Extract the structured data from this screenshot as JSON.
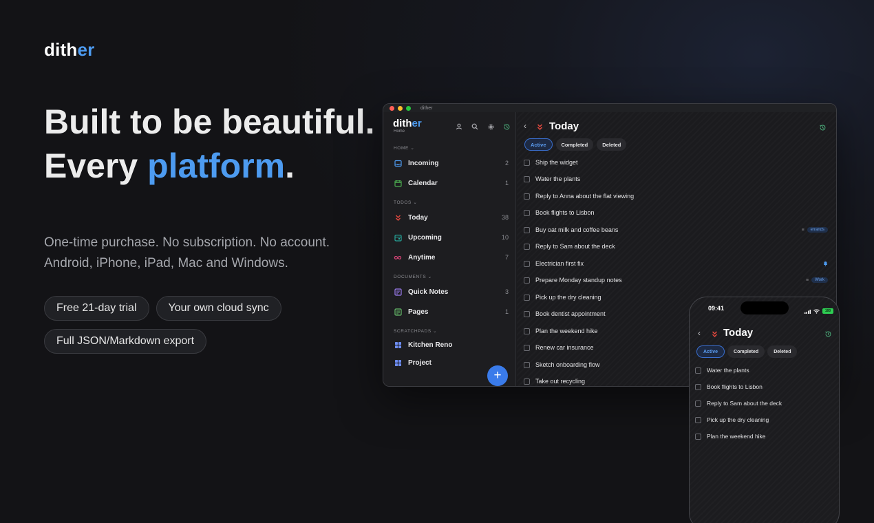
{
  "brand": {
    "text_a": "dith",
    "text_b": "er"
  },
  "headline": {
    "line1": "Built to be beautiful.",
    "line2_a": "Every ",
    "line2_b": "platform",
    "line2_c": "."
  },
  "subtitle": {
    "line1": "One-time purchase. No subscription. No account.",
    "line2": "Android, iPhone, iPad, Mac and Windows."
  },
  "pills": [
    "Free 21-day trial",
    "Your own cloud sync",
    "Full JSON/Markdown export"
  ],
  "desktop": {
    "window_title": "dither",
    "sidebar": {
      "brand_a": "dith",
      "brand_b": "er",
      "brand_sub": "Home",
      "sections": {
        "home": "HOME",
        "todos": "TODOS",
        "documents": "DOCUMENTS",
        "scratchpads": "SCRATCHPADS"
      },
      "items": [
        {
          "label": "Incoming",
          "count": "2"
        },
        {
          "label": "Calendar",
          "count": "1"
        },
        {
          "label": "Today",
          "count": "38"
        },
        {
          "label": "Upcoming",
          "count": "10"
        },
        {
          "label": "Anytime",
          "count": "7"
        },
        {
          "label": "Quick Notes",
          "count": "3"
        },
        {
          "label": "Pages",
          "count": "1"
        },
        {
          "label": "Kitchen Reno",
          "count": ""
        },
        {
          "label": "Project",
          "count": ""
        }
      ],
      "fab": "+"
    },
    "main": {
      "title": "Today",
      "tabs": [
        "Active",
        "Completed",
        "Deleted"
      ],
      "todos": [
        {
          "text": "Ship the widget",
          "tag": ""
        },
        {
          "text": "Water the plants",
          "tag": ""
        },
        {
          "text": "Reply to Anna about the flat viewing",
          "tag": ""
        },
        {
          "text": "Book flights to Lisbon",
          "tag": ""
        },
        {
          "text": "Buy oat milk and coffee beans",
          "tag": "errands"
        },
        {
          "text": "Reply to Sam about the deck",
          "tag": ""
        },
        {
          "text": "Electrician first fix",
          "tag": ""
        },
        {
          "text": "Prepare Monday standup notes",
          "tag": "Work"
        },
        {
          "text": "Pick up the dry cleaning",
          "tag": ""
        },
        {
          "text": "Book dentist appointment",
          "tag": ""
        },
        {
          "text": "Plan the weekend hike",
          "tag": ""
        },
        {
          "text": "Renew car insurance",
          "tag": ""
        },
        {
          "text": "Sketch onboarding flow",
          "tag": ""
        },
        {
          "text": "Take out recycling",
          "tag": ""
        }
      ]
    }
  },
  "phone": {
    "time": "09:41",
    "battery": "100",
    "title": "Today",
    "tabs": [
      "Active",
      "Completed",
      "Deleted"
    ],
    "todos": [
      "Water the plants",
      "Book flights to Lisbon",
      "Reply to Sam about the deck",
      "Pick up the dry cleaning",
      "Plan the weekend hike"
    ]
  },
  "colors": {
    "accent": "#4d9bf0",
    "fab": "#3a7bea",
    "today_icon": "#e5483e",
    "history_icon": "#4caf7c"
  }
}
